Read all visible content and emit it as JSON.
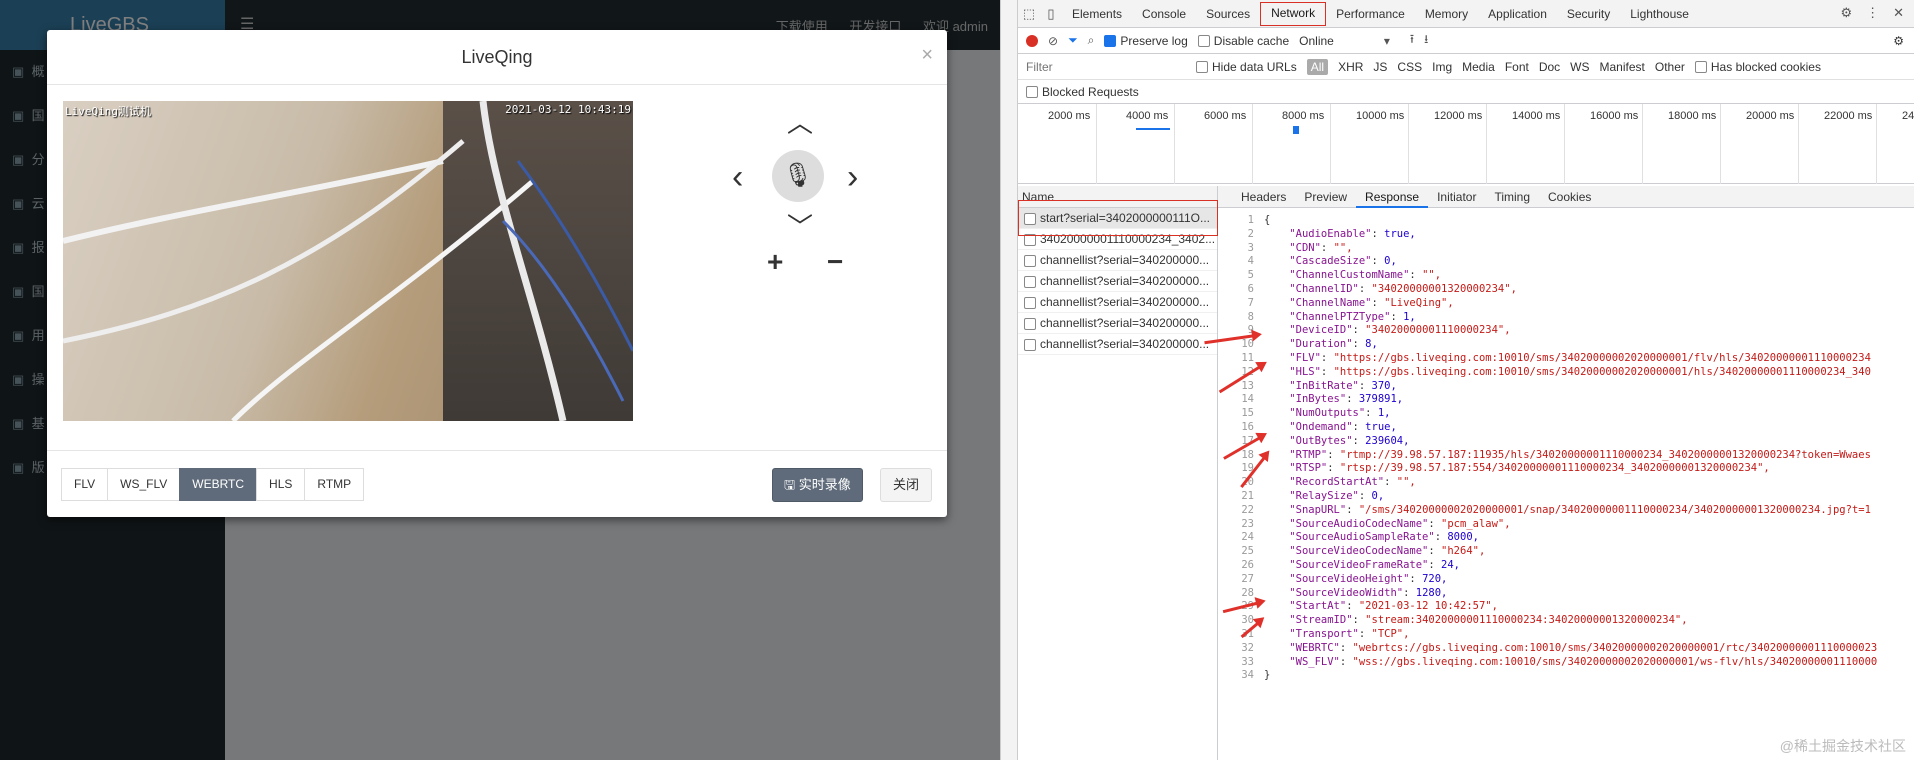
{
  "bg_app": {
    "brand": "LiveGBS",
    "menu_icon": "bars-icon",
    "top_links": [
      "下载使用",
      "开发接口",
      "欢迎 admin"
    ],
    "sidebar": [
      "概",
      "国",
      "分",
      "云",
      "报",
      "国",
      "用",
      "操",
      "基",
      "版"
    ]
  },
  "modal": {
    "title": "LiveQing",
    "close": "×",
    "video": {
      "overlay_label": "LiveQing测试机",
      "overlay_time": "2021-03-12 10:43:19"
    },
    "ptz": {
      "up": "⌃",
      "down": "⌄",
      "left": "‹",
      "right": "›",
      "zoom_in": "+",
      "zoom_out": "−"
    },
    "formats": [
      "FLV",
      "WS_FLV",
      "WEBRTC",
      "HLS",
      "RTMP"
    ],
    "active_format": "WEBRTC",
    "record_label": "实时录像",
    "close_label": "关闭"
  },
  "devtools": {
    "tabs": [
      "Elements",
      "Console",
      "Sources",
      "Network",
      "Performance",
      "Memory",
      "Application",
      "Security",
      "Lighthouse"
    ],
    "active_tab": "Network",
    "toolbar": {
      "preserve_log": "Preserve log",
      "disable_cache": "Disable cache",
      "throttle": "Online"
    },
    "filter": {
      "placeholder": "Filter",
      "hide_data_urls": "Hide data URLs",
      "types": [
        "All",
        "XHR",
        "JS",
        "CSS",
        "Img",
        "Media",
        "Font",
        "Doc",
        "WS",
        "Manifest",
        "Other"
      ],
      "has_blocked": "Has blocked cookies"
    },
    "blocked_requests": "Blocked Requests",
    "timeline_ticks": [
      "2000 ms",
      "4000 ms",
      "6000 ms",
      "8000 ms",
      "10000 ms",
      "12000 ms",
      "14000 ms",
      "16000 ms",
      "18000 ms",
      "20000 ms",
      "22000 ms",
      "24"
    ],
    "name_header": "Name",
    "requests": [
      "start?serial=3402000000111O...",
      "34020000001110000234_3402...",
      "channellist?serial=340200000...",
      "channellist?serial=340200000...",
      "channellist?serial=340200000...",
      "channellist?serial=340200000...",
      "channellist?serial=340200000..."
    ],
    "detail_tabs": [
      "Headers",
      "Preview",
      "Response",
      "Initiator",
      "Timing",
      "Cookies"
    ],
    "active_detail_tab": "Response",
    "response_lines": [
      "{",
      "    \"AudioEnable\": true,",
      "    \"CDN\": \"\",",
      "    \"CascadeSize\": 0,",
      "    \"ChannelCustomName\": \"\",",
      "    \"ChannelID\": \"34020000001320000234\",",
      "    \"ChannelName\": \"LiveQing\",",
      "    \"ChannelPTZType\": 1,",
      "    \"DeviceID\": \"34020000001110000234\",",
      "    \"Duration\": 8,",
      "    \"FLV\": \"https://gbs.liveqing.com:10010/sms/34020000002020000001/flv/hls/34020000001110000234",
      "    \"HLS\": \"https://gbs.liveqing.com:10010/sms/34020000002020000001/hls/34020000001110000234_340",
      "    \"InBitRate\": 370,",
      "    \"InBytes\": 379891,",
      "    \"NumOutputs\": 1,",
      "    \"Ondemand\": true,",
      "    \"OutBytes\": 239604,",
      "    \"RTMP\": \"rtmp://39.98.57.187:11935/hls/34020000001110000234_34020000001320000234?token=Wwaes",
      "    \"RTSP\": \"rtsp://39.98.57.187:554/34020000001110000234_34020000001320000234\",",
      "    \"RecordStartAt\": \"\",",
      "    \"RelaySize\": 0,",
      "    \"SnapURL\": \"/sms/34020000002020000001/snap/34020000001110000234/34020000001320000234.jpg?t=1",
      "    \"SourceAudioCodecName\": \"pcm_alaw\",",
      "    \"SourceAudioSampleRate\": 8000,",
      "    \"SourceVideoCodecName\": \"h264\",",
      "    \"SourceVideoFrameRate\": 24,",
      "    \"SourceVideoHeight\": 720,",
      "    \"SourceVideoWidth\": 1280,",
      "    \"StartAt\": \"2021-03-12 10:42:57\",",
      "    \"StreamID\": \"stream:34020000001110000234:34020000001320000234\",",
      "    \"Transport\": \"TCP\",",
      "    \"WEBRTC\": \"webrtcs://gbs.liveqing.com:10010/sms/34020000002020000001/rtc/34020000001110000023",
      "    \"WS_FLV\": \"wss://gbs.liveqing.com:10010/sms/34020000002020000001/ws-flv/hls/34020000001110000",
      "}"
    ]
  },
  "watermark": "@稀土掘金技术社区"
}
